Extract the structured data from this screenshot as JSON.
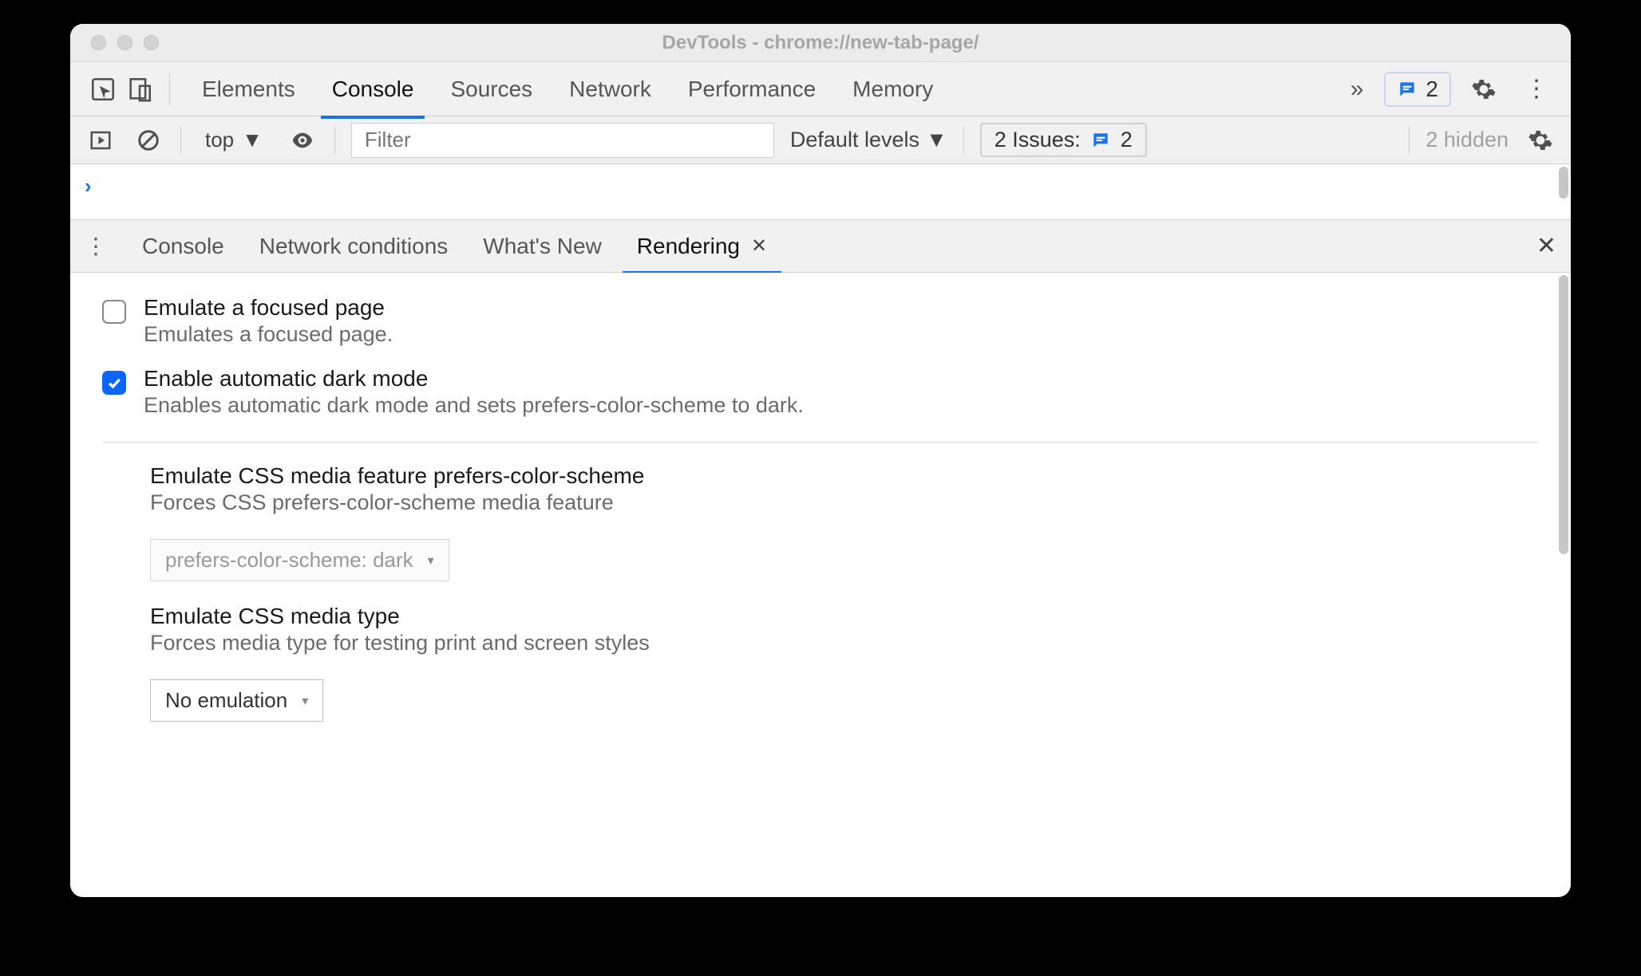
{
  "window": {
    "title": "DevTools - chrome://new-tab-page/"
  },
  "tabs": {
    "elements": "Elements",
    "console": "Console",
    "sources": "Sources",
    "network": "Network",
    "performance": "Performance",
    "memory": "Memory",
    "messages_count": "2"
  },
  "filterbar": {
    "context": "top",
    "filter_placeholder": "Filter",
    "levels": "Default levels",
    "issues_label": "2 Issues:",
    "issues_count": "2",
    "hidden": "2 hidden"
  },
  "console_prompt": "›",
  "drawer": {
    "console": "Console",
    "netcond": "Network conditions",
    "whatsnew": "What's New",
    "rendering": "Rendering"
  },
  "rendering": {
    "focused_title": "Emulate a focused page",
    "focused_desc": "Emulates a focused page.",
    "dark_title": "Enable automatic dark mode",
    "dark_desc": "Enables automatic dark mode and sets prefers-color-scheme to dark.",
    "pcs_title": "Emulate CSS media feature prefers-color-scheme",
    "pcs_desc": "Forces CSS prefers-color-scheme media feature",
    "pcs_value": "prefers-color-scheme: dark",
    "media_title": "Emulate CSS media type",
    "media_desc": "Forces media type for testing print and screen styles",
    "media_value": "No emulation"
  }
}
